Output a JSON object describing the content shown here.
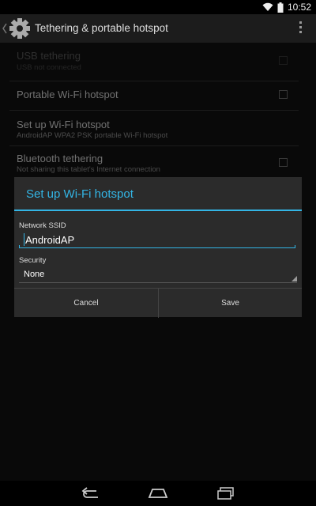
{
  "status": {
    "time": "10:52"
  },
  "actionbar": {
    "title": "Tethering & portable hotspot"
  },
  "settings": {
    "rows": [
      {
        "title": "USB tethering",
        "summary": "USB not connected"
      },
      {
        "title": "Portable Wi-Fi hotspot",
        "summary": ""
      },
      {
        "title": "Set up Wi-Fi hotspot",
        "summary": "AndroidAP WPA2 PSK portable Wi-Fi hotspot"
      },
      {
        "title": "Bluetooth tethering",
        "summary": "Not sharing this tablet's Internet connection"
      }
    ]
  },
  "dialog": {
    "title": "Set up Wi-Fi hotspot",
    "ssid_label": "Network SSID",
    "ssid_value": "AndroidAP",
    "security_label": "Security",
    "security_value": "None",
    "cancel_label": "Cancel",
    "save_label": "Save"
  },
  "colors": {
    "accent": "#33b5e5"
  },
  "icons": {
    "wifi": "wifi-icon",
    "battery": "battery-icon",
    "settings": "gear-icon",
    "overflow": "overflow-menu-icon",
    "back": "back-nav-icon",
    "home": "home-nav-icon",
    "recents": "recents-nav-icon"
  }
}
